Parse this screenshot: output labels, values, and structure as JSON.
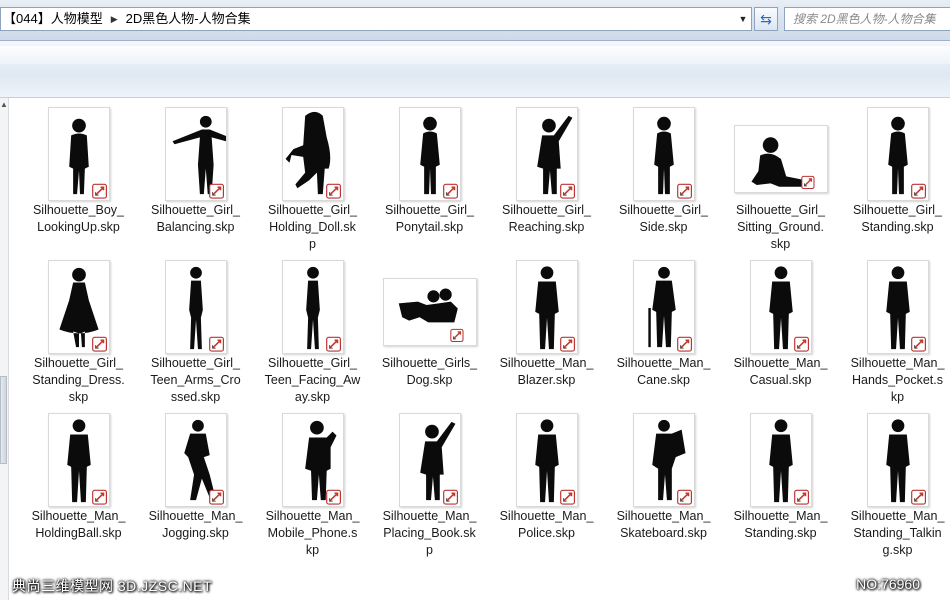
{
  "address_bar": {
    "crumbs": [
      "【044】人物模型",
      "2D黑色人物-人物合集"
    ],
    "search_placeholder": "搜索 2D黑色人物-人物合集"
  },
  "files": [
    {
      "name": "Silhouette_Boy_LookingUp.skp",
      "lines": [
        "Silhouette_Boy_",
        "LookingUp.skp"
      ],
      "pose": "boy"
    },
    {
      "name": "Silhouette_Girl_Balancing.skp",
      "lines": [
        "Silhouette_Girl_",
        "Balancing.skp"
      ],
      "pose": "arms-out"
    },
    {
      "name": "Silhouette_Girl_Holding_Doll.skp",
      "lines": [
        "Silhouette_Girl_",
        "Holding_Doll.sk",
        "p"
      ],
      "pose": "girl-doll"
    },
    {
      "name": "Silhouette_Girl_Ponytail.skp",
      "lines": [
        "Silhouette_Girl_",
        "Ponytail.skp"
      ],
      "pose": "girl"
    },
    {
      "name": "Silhouette_Girl_Reaching.skp",
      "lines": [
        "Silhouette_Girl_",
        "Reaching.skp"
      ],
      "pose": "reach"
    },
    {
      "name": "Silhouette_Girl_Side.skp",
      "lines": [
        "Silhouette_Girl_",
        "Side.skp"
      ],
      "pose": "girl"
    },
    {
      "name": "Silhouette_Girl_Sitting_Ground.skp",
      "lines": [
        "Silhouette_Girl_",
        "Sitting_Ground.",
        "skp"
      ],
      "pose": "sitting"
    },
    {
      "name": "Silhouette_Girl_Standing.skp",
      "lines": [
        "Silhouette_Girl_",
        "Standing.skp"
      ],
      "pose": "girl"
    },
    {
      "name": "Silhouette_Girl_Standing_Dress.skp",
      "lines": [
        "Silhouette_Girl_",
        "Standing_Dress.",
        "skp"
      ],
      "pose": "dress"
    },
    {
      "name": "Silhouette_Girl_Teen_Arms_Crossed.skp",
      "lines": [
        "Silhouette_Girl_",
        "Teen_Arms_Cro",
        "ssed.skp"
      ],
      "pose": "slim"
    },
    {
      "name": "Silhouette_Girl_Teen_Facing_Away.skp",
      "lines": [
        "Silhouette_Girl_",
        "Teen_Facing_Aw",
        "ay.skp"
      ],
      "pose": "slim"
    },
    {
      "name": "Silhouette_Girls_Dog.skp",
      "lines": [
        "Silhouette_Girls_",
        "Dog.skp"
      ],
      "pose": "dog"
    },
    {
      "name": "Silhouette_Man_Blazer.skp",
      "lines": [
        "Silhouette_Man_",
        "Blazer.skp"
      ],
      "pose": "man"
    },
    {
      "name": "Silhouette_Man_Cane.skp",
      "lines": [
        "Silhouette_Man_",
        "Cane.skp"
      ],
      "pose": "cane"
    },
    {
      "name": "Silhouette_Man_Casual.skp",
      "lines": [
        "Silhouette_Man_",
        "Casual.skp"
      ],
      "pose": "man"
    },
    {
      "name": "Silhouette_Man_Hands_Pocket.skp",
      "lines": [
        "Silhouette_Man_",
        "Hands_Pocket.s",
        "kp"
      ],
      "pose": "man"
    },
    {
      "name": "Silhouette_Man_HoldingBall.skp",
      "lines": [
        "Silhouette_Man_",
        "HoldingBall.skp"
      ],
      "pose": "man"
    },
    {
      "name": "Silhouette_Man_Jogging.skp",
      "lines": [
        "Silhouette_Man_",
        "Jogging.skp"
      ],
      "pose": "jog"
    },
    {
      "name": "Silhouette_Man_Mobile_Phone.skp",
      "lines": [
        "Silhouette_Man_",
        "Mobile_Phone.s",
        "kp"
      ],
      "pose": "phone"
    },
    {
      "name": "Silhouette_Man_Placing_Book.skp",
      "lines": [
        "Silhouette_Man_",
        "Placing_Book.sk",
        "p"
      ],
      "pose": "reach"
    },
    {
      "name": "Silhouette_Man_Police.skp",
      "lines": [
        "Silhouette_Man_",
        "Police.skp"
      ],
      "pose": "man"
    },
    {
      "name": "Silhouette_Man_Skateboard.skp",
      "lines": [
        "Silhouette_Man_",
        "Skateboard.skp"
      ],
      "pose": "skate"
    },
    {
      "name": "Silhouette_Man_Standing.skp",
      "lines": [
        "Silhouette_Man_",
        "Standing.skp"
      ],
      "pose": "man"
    },
    {
      "name": "Silhouette_Man_Standing_Talking.skp",
      "lines": [
        "Silhouette_Man_",
        "Standing_Talkin",
        "g.skp"
      ],
      "pose": "man"
    }
  ],
  "watermark": {
    "left": "典尚三维模型网 3D.JZSC.NET",
    "right": "NO:76960"
  }
}
